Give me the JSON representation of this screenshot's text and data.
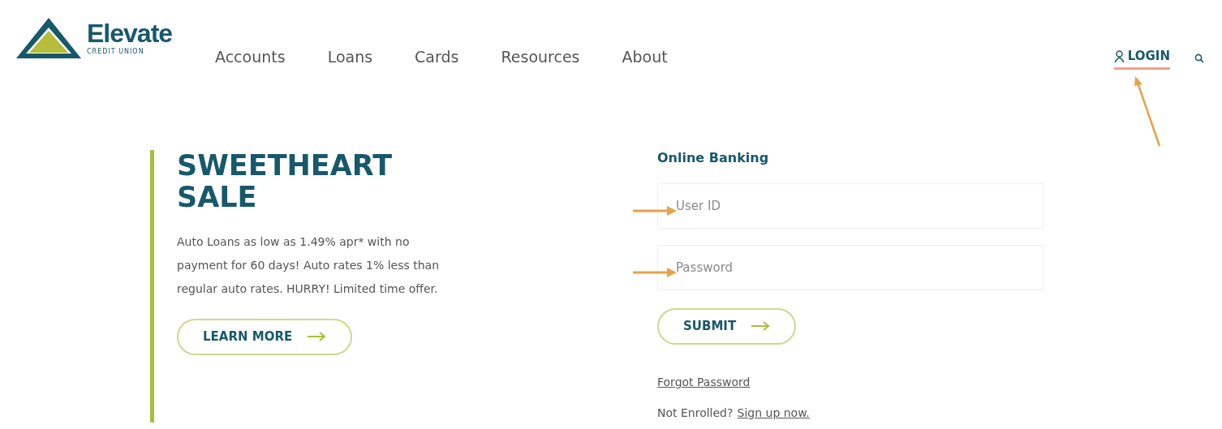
{
  "header": {
    "logo": {
      "name": "Elevate",
      "tagline": "CREDIT UNION"
    },
    "nav": [
      {
        "label": "Accounts"
      },
      {
        "label": "Loans"
      },
      {
        "label": "Cards"
      },
      {
        "label": "Resources"
      },
      {
        "label": "About"
      }
    ],
    "login": {
      "label": "LOGIN",
      "underlined": true
    }
  },
  "promo": {
    "title": "SWEETHEART SALE",
    "body": "Auto Loans as low as 1.49% apr* with no payment for 60 days! Auto rates 1% less than regular auto rates. HURRY! Limited time offer.",
    "button": "LEARN MORE"
  },
  "login_form": {
    "title": "Online Banking",
    "fields": [
      {
        "placeholder": "User ID"
      },
      {
        "placeholder": "Password"
      }
    ],
    "button": "SUBMIT",
    "forgot": "Forgot Password",
    "enroll_prompt": "Not Enrolled?",
    "enroll_link": "Sign up now."
  },
  "annotations": [
    {
      "kind": "diagonal"
    },
    {
      "kind": "horizontal"
    },
    {
      "kind": "horizontal"
    }
  ]
}
